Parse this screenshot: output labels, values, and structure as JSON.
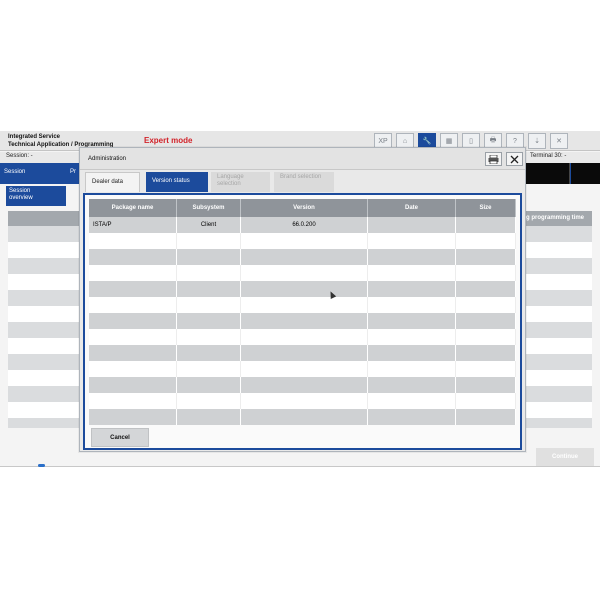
{
  "app": {
    "title_line1": "Integrated Service",
    "title_line2": "Technical Application / Programming",
    "mode": "Expert mode",
    "toolbar": [
      "XP",
      "⌂",
      "🔧",
      "▦",
      "▯",
      "🖶",
      "?",
      "⇣",
      "✕"
    ],
    "session_label": "Session:  -",
    "terminal_label": "Terminal 30:  -",
    "nav_session": "Session",
    "nav_pr": "Pr",
    "sub_tab_line1": "Session",
    "sub_tab_line2": "overview",
    "bg_header_text": "g programming time",
    "continue_label": "Continue"
  },
  "modal": {
    "title": "Administration",
    "print_icon": "printer-icon",
    "close_icon": "close-icon",
    "tabs": [
      {
        "label": "Dealer data",
        "state": "inactive"
      },
      {
        "label": "Version status",
        "state": "selected"
      },
      {
        "label_line1": "Language",
        "label_line2": "selection",
        "state": "disabled"
      },
      {
        "label": "Brand selection",
        "state": "disabled"
      }
    ],
    "table": {
      "columns": [
        "Package name",
        "Subsystem",
        "Version",
        "Date",
        "Size"
      ],
      "rows": [
        [
          "ISTA/P",
          "Client",
          "66.0.200",
          "",
          ""
        ]
      ]
    },
    "cancel_label": "Cancel"
  }
}
